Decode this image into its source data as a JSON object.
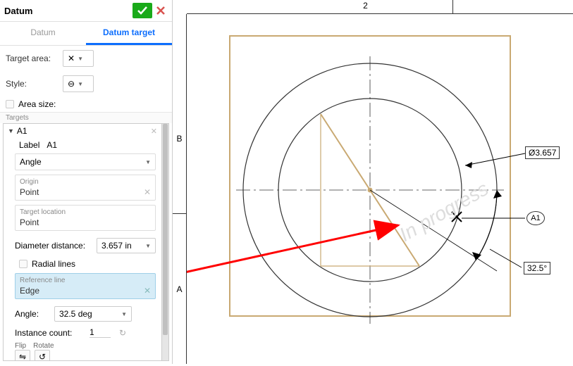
{
  "panel": {
    "title": "Datum",
    "tabs": {
      "datum": "Datum",
      "datum_target": "Datum target"
    },
    "target_area_label": "Target area:",
    "target_area_icon": "✕",
    "style_label": "Style:",
    "style_icon": "⊖",
    "area_size_label": "Area size:",
    "targets_header": "Targets",
    "item": {
      "name": "A1",
      "label_label": "Label",
      "label_value": "A1",
      "angle_mode": "Angle",
      "origin_label": "Origin",
      "origin_value": "Point",
      "target_loc_label": "Target location",
      "target_loc_value": "Point",
      "diameter_label": "Diameter distance:",
      "diameter_value": "3.657 in",
      "radial_lines": "Radial lines",
      "ref_line_label": "Reference line",
      "ref_line_value": "Edge",
      "angle2_label": "Angle:",
      "angle2_value": "32.5 deg",
      "instance_label": "Instance count:",
      "instance_value": "1",
      "flip": "Flip",
      "rotate": "Rotate"
    }
  },
  "canvas": {
    "col_label": "2",
    "row_top": "B",
    "row_bottom": "A",
    "diameter_callout": "Ø3.657",
    "datum_balloon": "A1",
    "angle_callout": "32.5°",
    "watermark": "In progress"
  },
  "chart_data": {
    "type": "diagram",
    "geometry": "Concentric circles with centerlines, diagonal chord, datum target point on outer ring",
    "outer_diameter_units": 3.657,
    "datum_target_label": "A1",
    "angular_dimension_deg": 32.5
  }
}
